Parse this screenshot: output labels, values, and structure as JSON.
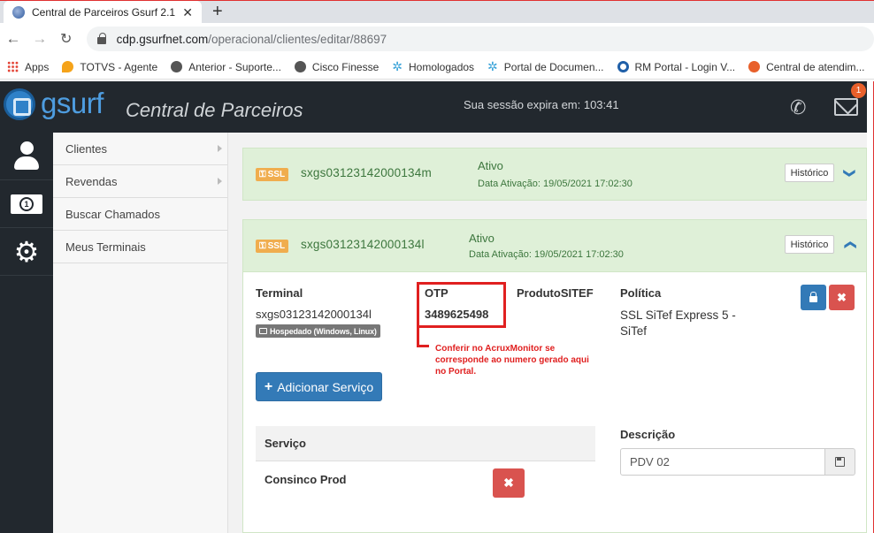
{
  "browser": {
    "tab_title": "Central de Parceiros Gsurf 2.1",
    "tab_close": "✕",
    "new_tab": "+",
    "url_host": "cdp.gsurfnet.com",
    "url_path": "/operacional/clientes/editar/88697",
    "bookmarks": [
      {
        "label": "Apps",
        "icon": "apps-grid-icon"
      },
      {
        "label": "TOTVS - Agente",
        "icon": "totvs-icon",
        "color": "#f5a31a"
      },
      {
        "label": "Anterior - Suporte...",
        "icon": "globe-icon",
        "color": "#555555"
      },
      {
        "label": "Cisco Finesse",
        "icon": "globe-icon",
        "color": "#555555"
      },
      {
        "label": "Homologados",
        "icon": "sparkle-icon",
        "color": "#3aa3d8"
      },
      {
        "label": "Portal de Documen...",
        "icon": "sparkle-icon",
        "color": "#3aa3d8"
      },
      {
        "label": "RM Portal - Login V...",
        "icon": "rm-icon",
        "color": "#1f5fa8"
      },
      {
        "label": "Central de atendim...",
        "icon": "central-icon",
        "color": "#e8602b"
      }
    ]
  },
  "header": {
    "logo_text": "gsurf",
    "app_title": "Central de Parceiros",
    "session_text": "Sua sessão expira em: 103:41",
    "notification_count": "1"
  },
  "submenu": {
    "items": [
      {
        "label": "Clientes",
        "has_caret": true
      },
      {
        "label": "Revendas",
        "has_caret": true
      },
      {
        "label": "Buscar Chamados",
        "has_caret": false
      },
      {
        "label": "Meus Terminais",
        "has_caret": false
      }
    ]
  },
  "terminals": [
    {
      "badge": "SSL",
      "name": "sxgs03123142000134m",
      "status": "Ativo",
      "activation": "Data Ativação: 19/05/2021 17:02:30",
      "history_label": "Histórico",
      "chevron": "❯"
    },
    {
      "badge": "SSL",
      "name": "sxgs03123142000134l",
      "status": "Ativo",
      "activation": "Data Ativação: 19/05/2021 17:02:30",
      "history_label": "Histórico",
      "chevron": "❯"
    }
  ],
  "detail": {
    "terminal_label": "Terminal",
    "terminal_value": "sxgs03123142000134l",
    "hosted_badge": "Hospedado (Windows, Linux)",
    "otp_label": "OTP",
    "otp_value": "3489625498",
    "produto_label": "ProdutoSITEF",
    "politica_label": "Política",
    "politica_value": "SSL SiTef Express 5 - SiTef",
    "annotation": "Conferir no AcruxMonitor se corresponde ao numero gerado aqui no Portal.",
    "delete_symbol": "✖",
    "add_service_label": "Adicionar Serviço",
    "service_col": "Serviço",
    "service_row": "Consinco Prod",
    "description_label": "Descrição",
    "description_value": "PDV 02"
  },
  "colors": {
    "header_bg": "#22282e",
    "panel_green": "#dff0d8",
    "primary": "#337ab7",
    "danger": "#d9534f",
    "annotation_red": "#e02020"
  }
}
